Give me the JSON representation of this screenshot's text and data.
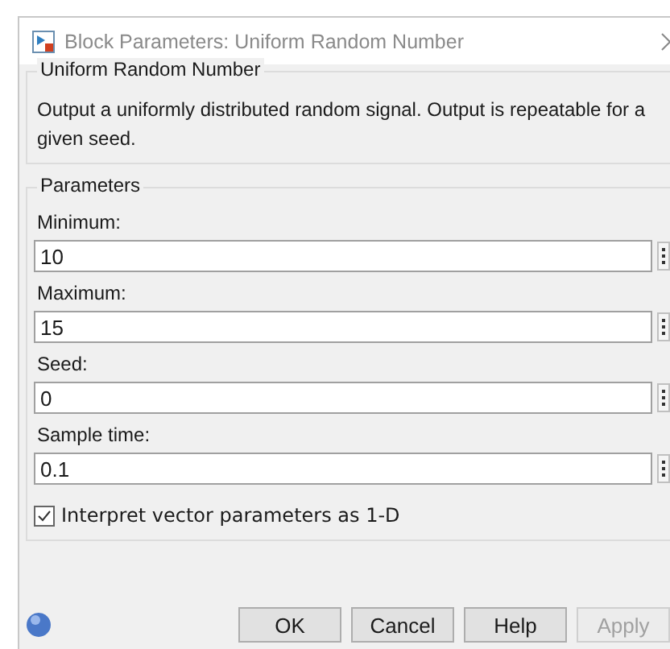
{
  "window": {
    "title": "Block Parameters: Uniform Random Number"
  },
  "block": {
    "name": "Uniform Random Number",
    "description": "Output a uniformly distributed random signal.  Output is repeatable for a given seed."
  },
  "parameters": {
    "title": "Parameters",
    "fields": [
      {
        "label": "Minimum:",
        "value": "10"
      },
      {
        "label": "Maximum:",
        "value": "15"
      },
      {
        "label": "Seed:",
        "value": "0"
      },
      {
        "label": "Sample time:",
        "value": "0.1"
      }
    ],
    "checkbox": {
      "label": "Interpret vector parameters as 1-D",
      "checked": true
    }
  },
  "buttons": [
    {
      "label": "OK",
      "disabled": false
    },
    {
      "label": "Cancel",
      "disabled": false
    },
    {
      "label": "Help",
      "disabled": false
    },
    {
      "label": "Apply",
      "disabled": true
    }
  ]
}
